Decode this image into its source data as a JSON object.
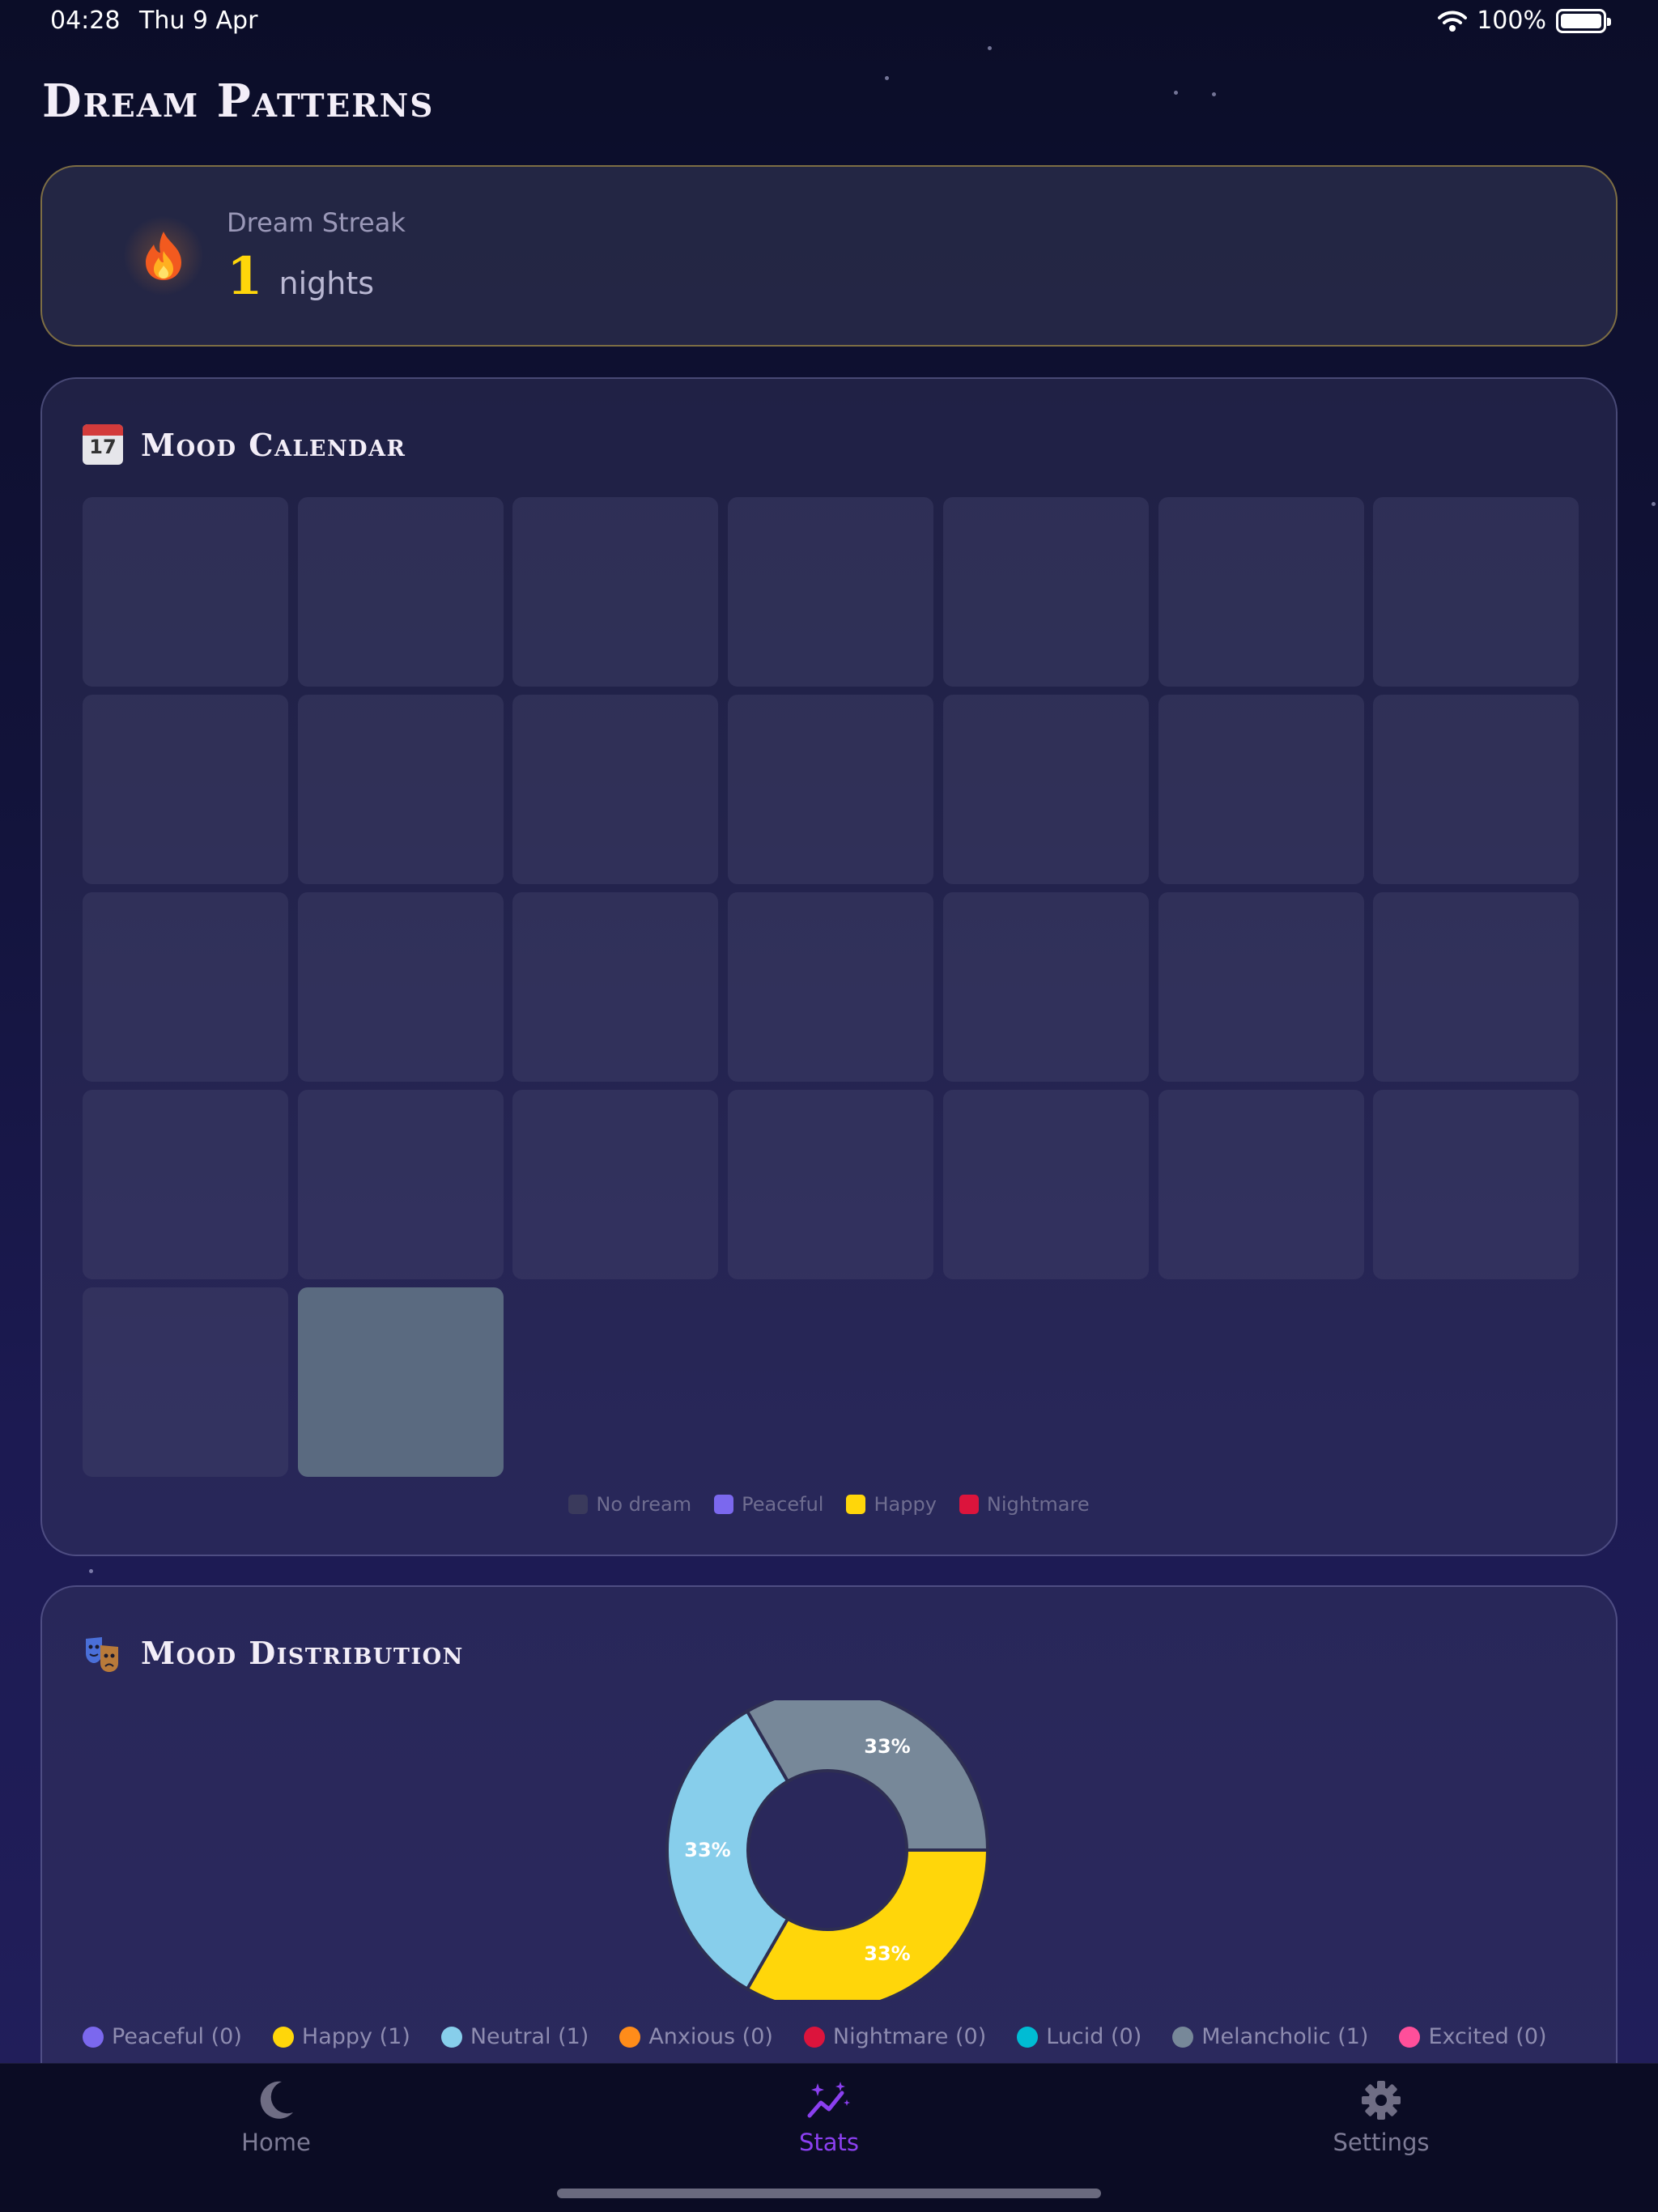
{
  "status_bar": {
    "time": "04:28",
    "date": "Thu 9 Apr",
    "battery": "100%"
  },
  "page": {
    "title": "Dream Patterns"
  },
  "streak": {
    "label": "Dream Streak",
    "value": "1",
    "unit": "nights",
    "icon": "flame-icon"
  },
  "calendar": {
    "title": "Mood Calendar",
    "icon": "calendar-icon",
    "icon_day": "17",
    "cell_count": 30,
    "days": [
      "none",
      "none",
      "none",
      "none",
      "none",
      "none",
      "none",
      "none",
      "none",
      "none",
      "none",
      "none",
      "none",
      "none",
      "none",
      "none",
      "none",
      "none",
      "none",
      "none",
      "none",
      "none",
      "none",
      "none",
      "none",
      "none",
      "none",
      "none",
      "none",
      "dream"
    ],
    "legend": [
      {
        "label": "No dream",
        "color": "#3a3a5c"
      },
      {
        "label": "Peaceful",
        "color": "#7b68ee"
      },
      {
        "label": "Happy",
        "color": "#ffd60a"
      },
      {
        "label": "Nightmare",
        "color": "#dc143c"
      }
    ]
  },
  "distribution": {
    "title": "Mood Distribution",
    "icon": "theater-masks-icon",
    "legend": [
      {
        "label": "Peaceful (0)",
        "color": "#7b68ee"
      },
      {
        "label": "Happy (1)",
        "color": "#ffd60a"
      },
      {
        "label": "Neutral (1)",
        "color": "#87ceeb"
      },
      {
        "label": "Anxious (0)",
        "color": "#ff8c1a"
      },
      {
        "label": "Nightmare (0)",
        "color": "#dc143c"
      },
      {
        "label": "Lucid (0)",
        "color": "#00bcd4"
      },
      {
        "label": "Melancholic (1)",
        "color": "#778899"
      },
      {
        "label": "Excited (0)",
        "color": "#ff4f9a"
      }
    ]
  },
  "chart_data": {
    "type": "pie",
    "title": "",
    "categories": [
      "Happy",
      "Neutral",
      "Melancholic"
    ],
    "values": [
      1,
      1,
      1
    ],
    "labels": [
      "33%",
      "33%",
      "33%"
    ],
    "colors": [
      "#ffd60a",
      "#87ceeb",
      "#778899"
    ]
  },
  "tabs": [
    {
      "label": "Home",
      "icon": "moon-icon"
    },
    {
      "label": "Stats",
      "icon": "stats-sparkle-icon"
    },
    {
      "label": "Settings",
      "icon": "gear-icon"
    }
  ]
}
